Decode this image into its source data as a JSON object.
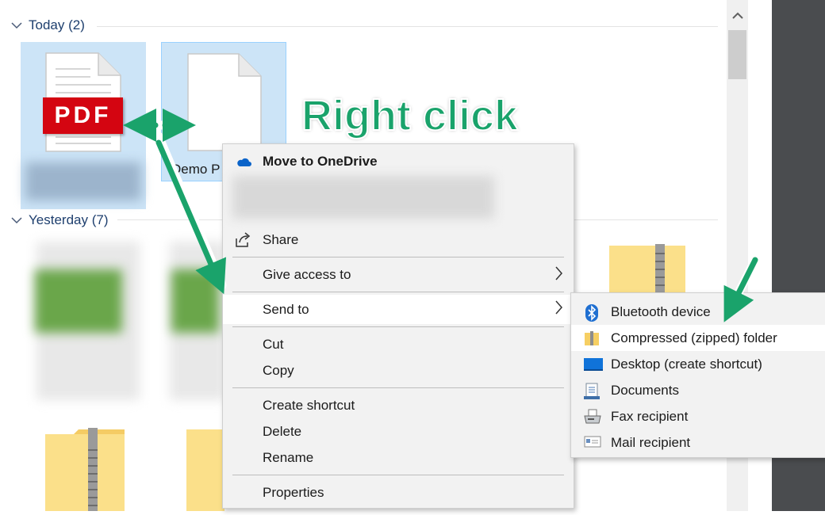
{
  "explorer": {
    "groups": [
      {
        "label": "Today (2)"
      },
      {
        "label": "Yesterday (7)"
      }
    ],
    "files": {
      "pdf_badge": "PDF",
      "demo_name": "Demo P"
    }
  },
  "annotation": {
    "title": "Right click"
  },
  "context_menu": {
    "items": [
      {
        "label": "Move to OneDrive",
        "icon": "onedrive-icon"
      },
      {
        "label": "Share",
        "icon": "share-icon"
      },
      {
        "label": "Give access to"
      },
      {
        "label": "Send to"
      },
      {
        "label": "Cut"
      },
      {
        "label": "Copy"
      },
      {
        "label": "Create shortcut"
      },
      {
        "label": "Delete"
      },
      {
        "label": "Rename"
      },
      {
        "label": "Properties"
      }
    ],
    "submenu_arrow": "›"
  },
  "send_to": {
    "items": [
      {
        "label": "Bluetooth device",
        "icon": "bluetooth-icon"
      },
      {
        "label": "Compressed (zipped) folder",
        "icon": "zip-folder-icon"
      },
      {
        "label": "Desktop (create shortcut)",
        "icon": "desktop-icon"
      },
      {
        "label": "Documents",
        "icon": "documents-icon"
      },
      {
        "label": "Fax recipient",
        "icon": "fax-icon"
      },
      {
        "label": "Mail recipient",
        "icon": "mail-icon"
      }
    ]
  },
  "colors": {
    "selection": "#cce4f7",
    "annotation": "#1aa36b",
    "menu_bg": "#f2f2f2"
  }
}
